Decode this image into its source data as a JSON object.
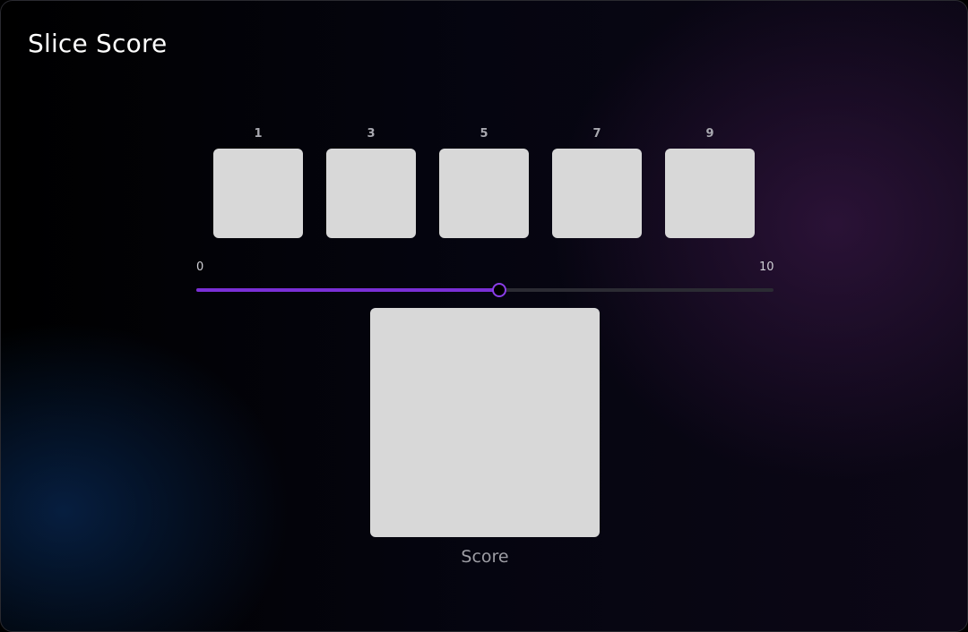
{
  "app": {
    "title": "Slice Score"
  },
  "slices": [
    {
      "label": "1"
    },
    {
      "label": "3"
    },
    {
      "label": "5"
    },
    {
      "label": "7"
    },
    {
      "label": "9"
    }
  ],
  "slider": {
    "min_label": "0",
    "max_label": "10",
    "min": 0,
    "max": 10,
    "value": 5.25,
    "accent_color": "#7a2fd6"
  },
  "score": {
    "label": "Score"
  }
}
